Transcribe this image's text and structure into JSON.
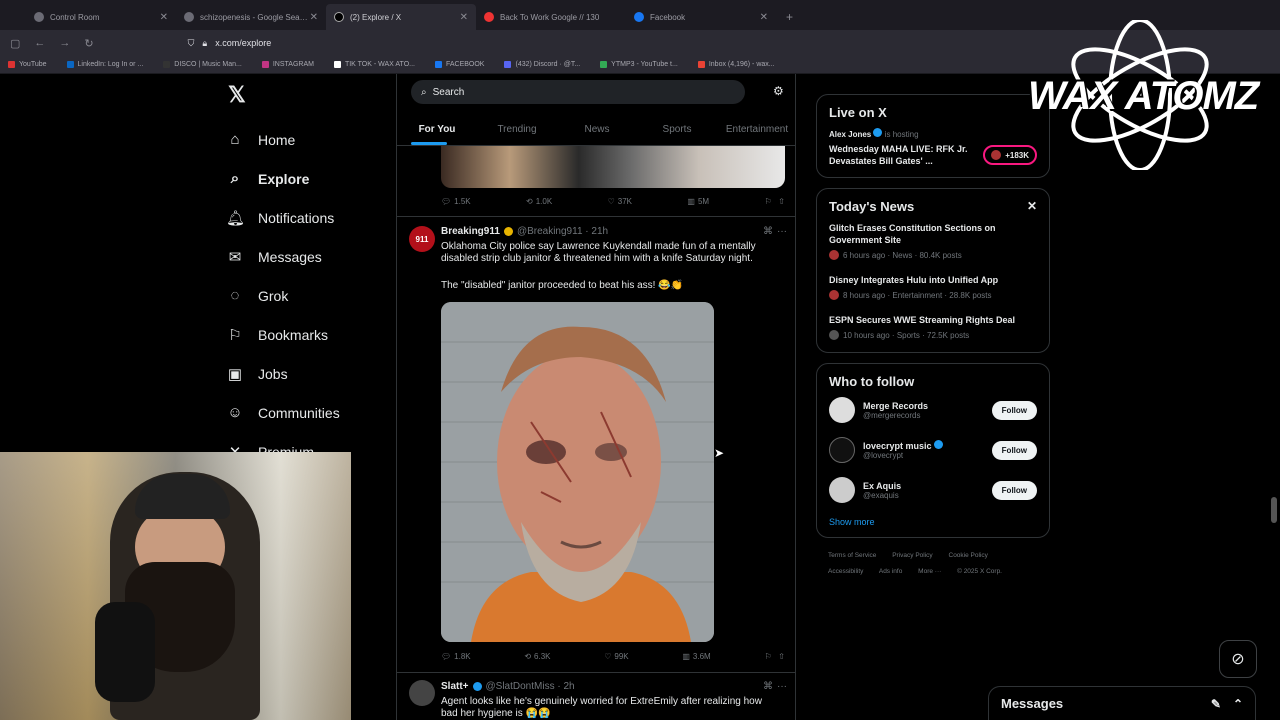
{
  "browser": {
    "tabs": [
      {
        "title": "Control Room",
        "active": false
      },
      {
        "title": "schizopenesis - Google Search",
        "active": false
      },
      {
        "title": "(2) Explore / X",
        "active": true
      },
      {
        "title": "Back To Work Google // 130",
        "active": false
      },
      {
        "title": "Facebook",
        "active": false
      }
    ],
    "url": "x.com/explore",
    "bookmarks": [
      "YouTube",
      "LinkedIn: Log In or ...",
      "DISCO | Music Man...",
      "INSTAGRAM",
      "TIK TOK - WAX ATO...",
      "FACEBOOK",
      "(432) Discord · @T...",
      "YTMP3 - YouTube t...",
      "Inbox (4,196) - wax..."
    ]
  },
  "nav": {
    "items": [
      {
        "label": "Home",
        "icon": "home-icon",
        "glyph": "⌂"
      },
      {
        "label": "Explore",
        "icon": "search-icon",
        "glyph": "⌕"
      },
      {
        "label": "Notifications",
        "icon": "bell-icon",
        "glyph": "♫"
      },
      {
        "label": "Messages",
        "icon": "mail-icon",
        "glyph": "✉"
      },
      {
        "label": "Grok",
        "icon": "grok-icon",
        "glyph": "◌"
      },
      {
        "label": "Bookmarks",
        "icon": "bookmark-icon",
        "glyph": "⚑"
      },
      {
        "label": "Jobs",
        "icon": "briefcase-icon",
        "glyph": "▣"
      },
      {
        "label": "Communities",
        "icon": "people-icon",
        "glyph": "☺"
      },
      {
        "label": "Premium",
        "icon": "x-premium-icon",
        "glyph": "✕"
      }
    ]
  },
  "feed": {
    "search_placeholder": "Search",
    "tabs": [
      "For You",
      "Trending",
      "News",
      "Sports",
      "Entertainment"
    ],
    "top_actions": {
      "replies": "1.5K",
      "reposts": "1.0K",
      "likes": "37K",
      "views": "5M"
    },
    "tweet1": {
      "avatar_text": "911",
      "name": "Breaking911",
      "handle": "@Breaking911 · 21h",
      "text1": "Oklahoma City police say Lawrence Kuykendall made fun of a mentally disabled strip club janitor & threatened him with a knife Saturday night.",
      "text2": "The \"disabled\" janitor proceeded to beat his ass! 😂👏",
      "actions": {
        "replies": "1.8K",
        "reposts": "6.3K",
        "likes": "99K",
        "views": "3.6M"
      }
    },
    "tweet2": {
      "name": "Slatt+",
      "handle": "@SlatDontMiss · 2h",
      "text": "Agent looks like he's genuinely worried for ExtreEmily after realizing how bad her hygiene is 😭😭"
    }
  },
  "right": {
    "live": {
      "heading": "Live on X",
      "host": "Alex Jones",
      "status": "is hosting",
      "title": "Wednesday MAHA LIVE: RFK Jr. Devastates Bill Gates' ...",
      "listeners": "+183K"
    },
    "news": {
      "heading": "Today's News",
      "items": [
        {
          "title": "Glitch Erases Constitution Sections on Government Site",
          "meta": "6 hours ago · News · 80.4K posts"
        },
        {
          "title": "Disney Integrates Hulu into Unified App",
          "meta": "8 hours ago · Entertainment · 28.8K posts"
        },
        {
          "title": "ESPN Secures WWE Streaming Rights Deal",
          "meta": "10 hours ago · Sports · 72.5K posts"
        }
      ]
    },
    "who": {
      "heading": "Who to follow",
      "items": [
        {
          "name": "Merge Records",
          "handle": "@mergerecords",
          "verified": false
        },
        {
          "name": "lovecrypt music",
          "handle": "@lovecrypt",
          "verified": true
        },
        {
          "name": "Ex Aquis",
          "handle": "@exaquis",
          "verified": false
        }
      ],
      "follow_label": "Follow",
      "show_more": "Show more"
    },
    "footer": [
      "Terms of Service",
      "Privacy Policy",
      "Cookie Policy",
      "Accessibility",
      "Ads info",
      "More ···",
      "© 2025 X Corp."
    ]
  },
  "overlay": {
    "logo_text": "WAX ATOMZ"
  },
  "messages_bar": {
    "label": "Messages"
  },
  "colors": {
    "accent": "#1d9bf0",
    "live": "#f91880",
    "background": "#000000"
  }
}
